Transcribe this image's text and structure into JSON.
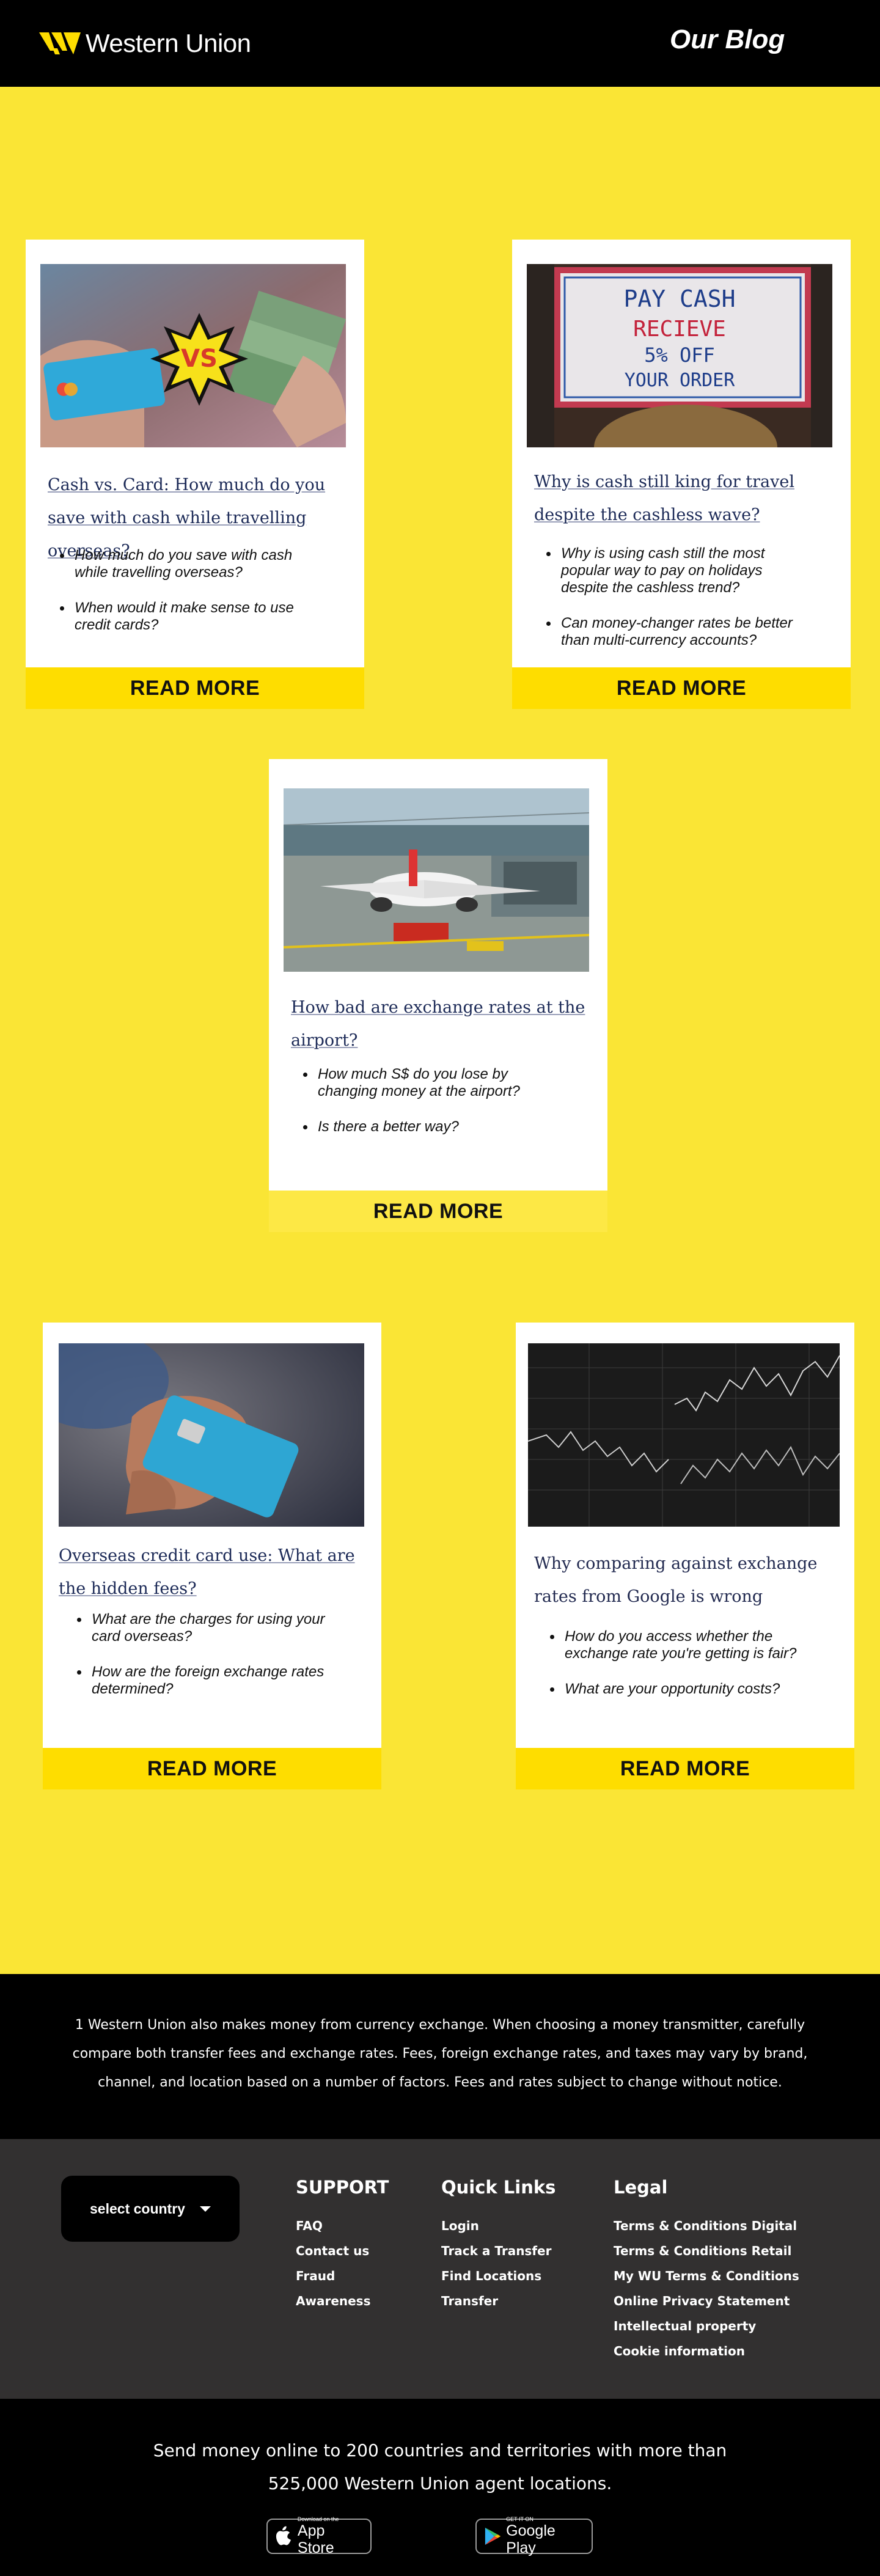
{
  "header": {
    "brand": "Western Union",
    "page_title": "Our Blog"
  },
  "cards": [
    {
      "title": "Cash vs. Card: How much do you save with cash while travelling overseas?",
      "image_badge": "VS",
      "bullets": [
        "How much do you save with cash while travelling overseas?",
        "When would it make sense to use credit cards?"
      ],
      "button": "READ MORE"
    },
    {
      "title": "Why is cash still king for travel despite the cashless wave?",
      "image_sign": [
        "PAY CASH",
        "RECIEVE",
        "5% OFF",
        "YOUR ORDER"
      ],
      "bullets": [
        "Why is using cash still the most popular way to pay on holidays despite the cashless trend?",
        "Can money-changer rates be better than multi-currency accounts?"
      ],
      "button": "READ MORE"
    },
    {
      "title": "How bad are exchange rates at the airport?",
      "bullets": [
        "How much S$ do you lose by changing money at the airport?",
        "Is there a better way?"
      ],
      "button": "READ MORE"
    },
    {
      "title": "Overseas credit card use: What are the hidden fees?",
      "bullets": [
        "What are the charges for using your card overseas?",
        "How are the foreign exchange rates determined?"
      ],
      "button": "READ MORE"
    },
    {
      "title": "Why comparing against exchange rates from Google is wrong",
      "bullets": [
        "How do you access whether the exchange rate you're getting is fair?",
        "What are your opportunity costs?"
      ],
      "button": "READ MORE"
    }
  ],
  "disclaimer": "1 Western Union also makes money from currency exchange. When choosing a money transmitter, carefully compare both transfer fees and exchange rates. Fees, foreign exchange rates, and taxes may vary by brand, channel, and location based on a number of factors. Fees and rates subject to change without notice.",
  "footer": {
    "country_select": "select country",
    "support": {
      "heading": "SUPPORT",
      "links": [
        "FAQ",
        "Contact us",
        "Fraud",
        "Awareness"
      ]
    },
    "quick_links": {
      "heading": "Quick Links",
      "links": [
        "Login",
        "Track a Transfer",
        "Find Locations",
        "Transfer"
      ]
    },
    "legal": {
      "heading": "Legal",
      "links": [
        "Terms & Conditions Digital",
        "Terms & Conditions Retail",
        "My WU Terms & Conditions",
        "Online Privacy Statement",
        "Intellectual property",
        "Cookie information"
      ]
    }
  },
  "bottom": {
    "text": "Send money online to 200 countries and territories with more than 525,000 Western Union agent locations.",
    "app_store": {
      "small": "Download on the",
      "big": "App Store"
    },
    "google_play": {
      "small": "GET IT ON",
      "big": "Google Play"
    }
  },
  "colors": {
    "brand_yellow": "#fedd00",
    "page_yellow": "#fae535",
    "header_black": "#000000",
    "footer_gray": "#323030",
    "link_navy": "#1c2a57"
  }
}
